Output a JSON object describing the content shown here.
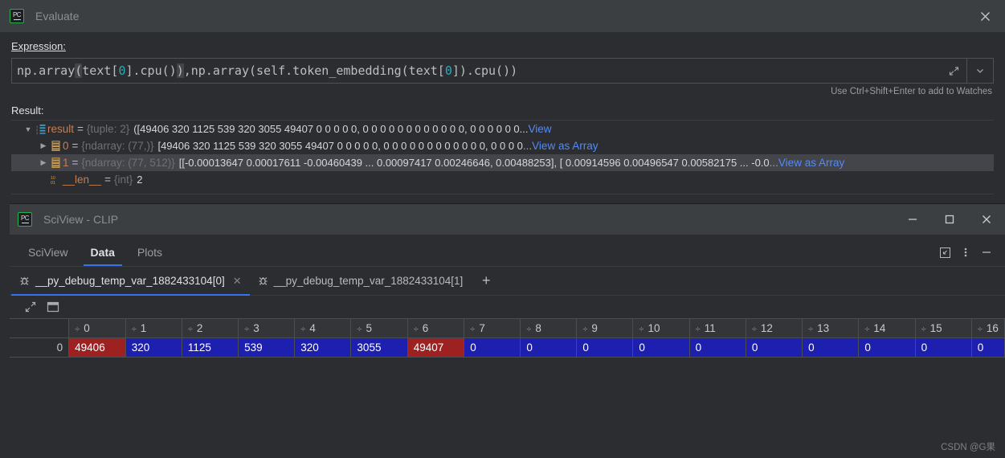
{
  "evaluate_dialog": {
    "title": "Evaluate",
    "logo_text": "PC",
    "expression_label": "Expression:",
    "expression_parts": [
      {
        "t": "np.array",
        "k": "tok"
      },
      {
        "t": "(",
        "k": "brhl"
      },
      {
        "t": "text[",
        "k": "tok"
      },
      {
        "t": "0",
        "k": "num"
      },
      {
        "t": "].cpu()",
        "k": "tok"
      },
      {
        "t": ")",
        "k": "brhl"
      },
      {
        "t": ",np.array(self.token_embedding(text[",
        "k": "tok"
      },
      {
        "t": "0",
        "k": "num"
      },
      {
        "t": "]).cpu())",
        "k": "tok"
      }
    ],
    "expression_value": "np.array(text[0].cpu()),np.array(self.token_embedding(text[0]).cpu())",
    "expand_icon": "expand-arrow-icon",
    "dropdown_icon": "chevron-down-icon",
    "hint": "Use Ctrl+Shift+Enter to add to Watches",
    "result_label": "Result:",
    "tree_rows": [
      {
        "arrow": "▼",
        "icon": "tuple-icon",
        "name": "result",
        "eq": "=",
        "type": "{tuple: 2}",
        "value": "([49406   320  1125   539   320  3055 49407    0    0    0    0    0,   0    0    0    0    0    0    0    0    0    0    0    0,   0    0    0    0    0    0...",
        "link": "View",
        "link_prefix": "",
        "selected": false,
        "indent": 0
      },
      {
        "arrow": "▶",
        "icon": "ndarray-icon",
        "name": "0",
        "eq": "=",
        "type": "{ndarray: (77,)}",
        "value": "[49406   320  1125   539   320  3055 49407    0    0    0    0    0,    0    0    0    0    0    0    0    0    0    0    0    0,    0    0    0    0",
        "link": "View as Array",
        "link_prefix": "...",
        "selected": false,
        "indent": 1
      },
      {
        "arrow": "▶",
        "icon": "ndarray-icon",
        "name": "1",
        "eq": "=",
        "type": "{ndarray: (77, 512)}",
        "value": "[[-0.00013647  0.00017611 -0.00460439 ...  0.00097417  0.00246646,   0.00488253], [ 0.00914596  0.00496547  0.00582175 ... -0.0",
        "link": "View as Array",
        "link_prefix": "...",
        "selected": true,
        "indent": 1
      },
      {
        "arrow": "",
        "icon": "int-icon",
        "name": "__len__",
        "eq": "=",
        "type": "{int}",
        "value": "2",
        "link": "",
        "link_prefix": "",
        "selected": false,
        "indent": 1
      }
    ]
  },
  "sciview": {
    "window_title": "SciView - CLIP",
    "logo_text": "PC",
    "window_controls": [
      {
        "name": "minimize-button",
        "glyph": "—"
      },
      {
        "name": "maximize-button",
        "glyph": "☐"
      },
      {
        "name": "close-button",
        "glyph": "✕"
      }
    ],
    "tabs": [
      {
        "label": "SciView",
        "active": false
      },
      {
        "label": "Data",
        "active": true
      },
      {
        "label": "Plots",
        "active": false
      }
    ],
    "panel_tools": [
      {
        "name": "collapse-panel-icon"
      },
      {
        "name": "more-options-icon"
      },
      {
        "name": "hide-panel-icon"
      }
    ],
    "data_tabs": [
      {
        "label": "__py_debug_temp_var_1882433104[0]",
        "active": true,
        "closable": true,
        "icon": "bug-icon"
      },
      {
        "label": "__py_debug_temp_var_1882433104[1]",
        "active": false,
        "closable": false,
        "icon": "bug-icon"
      }
    ],
    "add_tab_glyph": "+",
    "grid_toolbar": [
      {
        "name": "open-in-new-window-icon"
      },
      {
        "name": "toggle-view-icon"
      }
    ]
  },
  "table_data": {
    "sort_glyph": "÷",
    "row_header": "",
    "columns": [
      "0",
      "1",
      "2",
      "3",
      "4",
      "5",
      "6",
      "7",
      "8",
      "9",
      "10",
      "11",
      "12",
      "13",
      "14",
      "15",
      "16"
    ],
    "rows": [
      {
        "index": "0",
        "cells": [
          {
            "v": "49406",
            "color": "red"
          },
          {
            "v": "320",
            "color": "blue"
          },
          {
            "v": "1125",
            "color": "blue"
          },
          {
            "v": "539",
            "color": "blue"
          },
          {
            "v": "320",
            "color": "blue"
          },
          {
            "v": "3055",
            "color": "blue"
          },
          {
            "v": "49407",
            "color": "red"
          },
          {
            "v": "0",
            "color": "blue"
          },
          {
            "v": "0",
            "color": "blue"
          },
          {
            "v": "0",
            "color": "blue"
          },
          {
            "v": "0",
            "color": "blue"
          },
          {
            "v": "0",
            "color": "blue"
          },
          {
            "v": "0",
            "color": "blue"
          },
          {
            "v": "0",
            "color": "blue"
          },
          {
            "v": "0",
            "color": "blue"
          },
          {
            "v": "0",
            "color": "blue"
          },
          {
            "v": "0",
            "color": "blue"
          }
        ]
      }
    ]
  },
  "watermark": "CSDN @G果",
  "colors": {
    "accent_blue": "#3573f0",
    "link_blue": "#548af7",
    "cell_blue": "#1d1fae",
    "cell_red": "#9e2122",
    "variable_orange": "#c77d53",
    "background": "#2b2d30",
    "titlebar": "#3c3f41"
  }
}
